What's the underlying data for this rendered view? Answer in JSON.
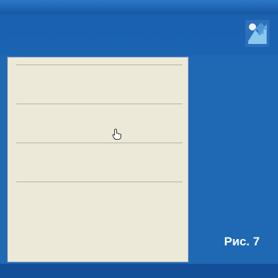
{
  "window": {
    "title": "",
    "intro": ""
  },
  "groups": [
    {
      "label": "",
      "links": [
        {
          "label": "",
          "state": "normal"
        },
        {
          "label": "",
          "state": "normal"
        },
        {
          "label": "",
          "state": "normal"
        }
      ]
    },
    {
      "label": "",
      "links": [
        {
          "label": "",
          "state": "active"
        },
        {
          "label": "",
          "state": "normal"
        },
        {
          "label": "",
          "state": "normal"
        }
      ]
    },
    {
      "label": "",
      "links": [
        {
          "label": "",
          "state": "normal"
        },
        {
          "label": "",
          "state": "normal"
        },
        {
          "label": "",
          "state": "normal"
        }
      ]
    },
    {
      "label": "",
      "links": [
        {
          "label": "",
          "state": "normal"
        },
        {
          "label": "",
          "state": "normal"
        },
        {
          "label": "",
          "state": "normal"
        }
      ]
    }
  ],
  "side_panel": {
    "text": ""
  },
  "caption": "Рис. 7",
  "footer": {
    "link": ""
  },
  "colors": {
    "window_bg": "#1f68b3",
    "panel_bg": "#ece9d8",
    "link": "#1010b8",
    "link_active": "#d82c10"
  },
  "icons": {
    "logo": "setup-logo-icon",
    "cursor": "hand-pointer-icon"
  }
}
